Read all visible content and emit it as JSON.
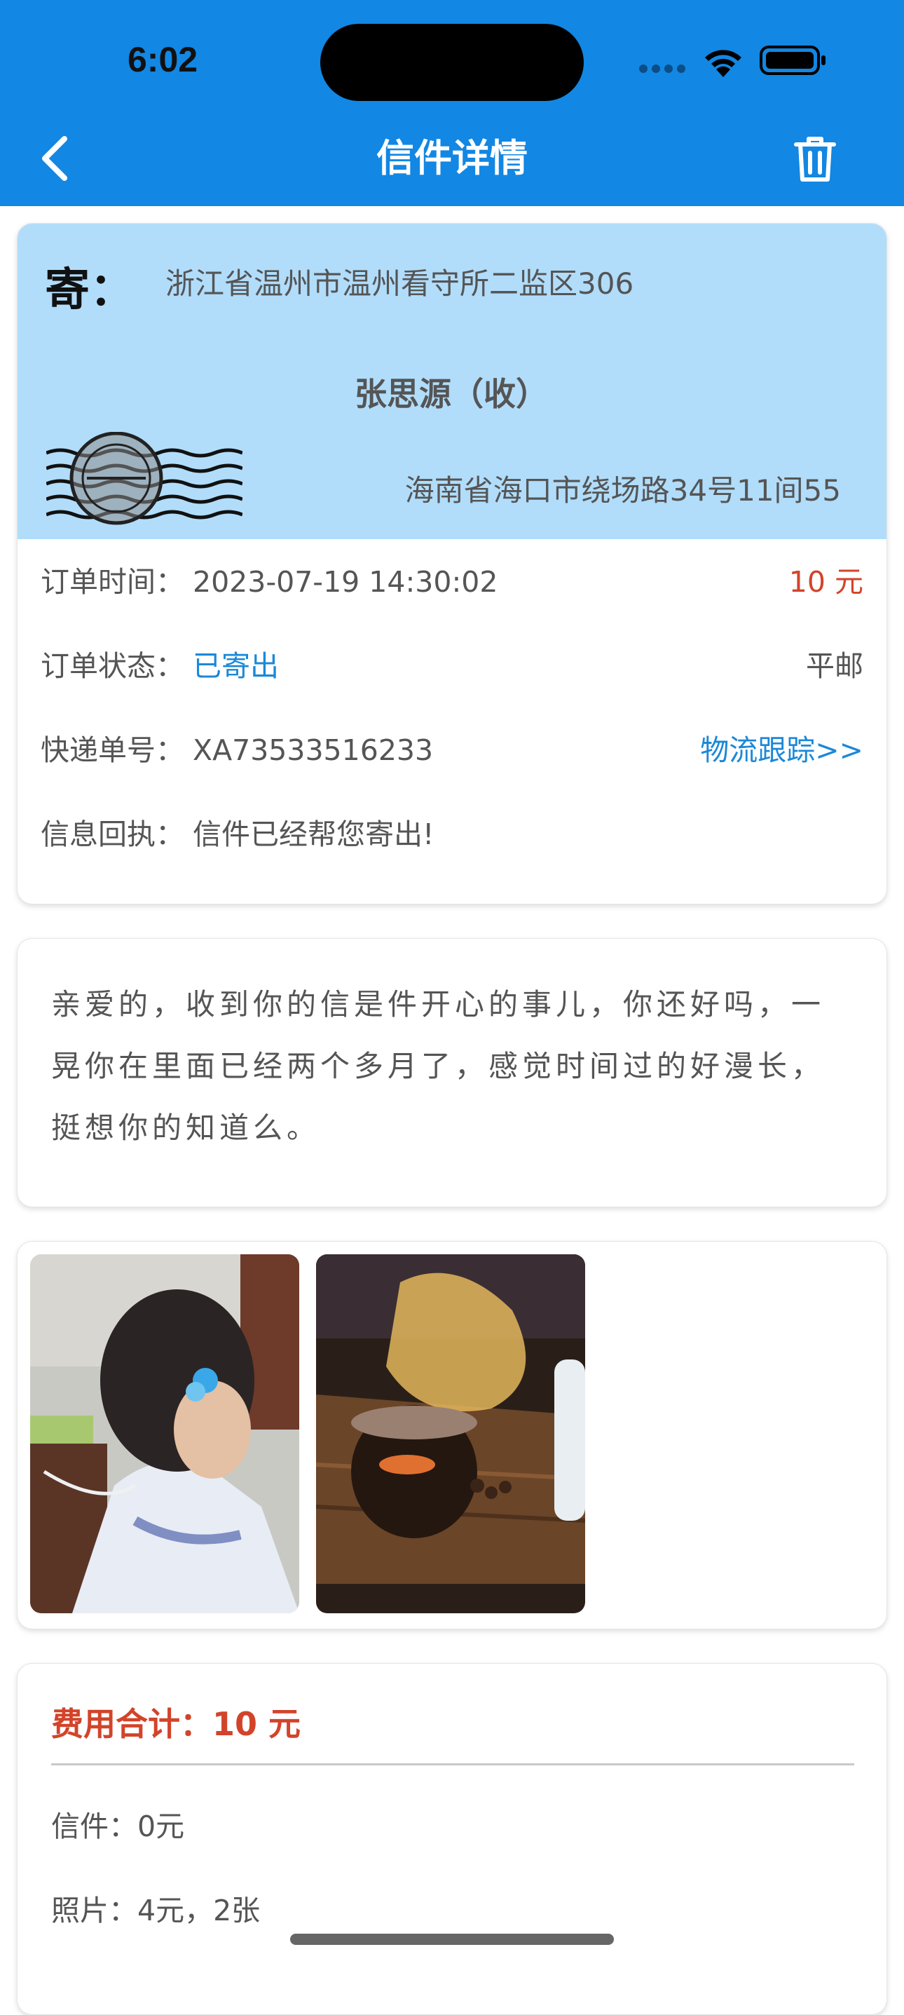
{
  "status_bar": {
    "time": "6:02"
  },
  "nav": {
    "title": "信件详情"
  },
  "envelope": {
    "sender_label": "寄：",
    "sender_address": "浙江省温州市温州看守所二监区306",
    "receiver_name": "张思源（收）",
    "receiver_address": "海南省海口市绕场路34号11间55"
  },
  "order": {
    "time_label": "订单时间：",
    "time_value": "2023-07-19 14:30:02",
    "price": "10 元",
    "status_label": "订单状态：",
    "status_value": "已寄出",
    "mail_type": "平邮",
    "tracking_label": "快递单号：",
    "tracking_value": "XA73533516233",
    "tracking_link": "物流跟踪>>",
    "receipt_label": "信息回执：",
    "receipt_value": "信件已经帮您寄出!"
  },
  "message": {
    "text": "亲爱的，收到你的信是件开心的事儿，你还好吗，一晃你在里面已经两个多月了，感觉时间过的好漫长，挺想你的知道么。"
  },
  "photos": [
    "girl-photo",
    "drink-photo"
  ],
  "fees": {
    "total_label": "费用合计：",
    "total_value": "10 元",
    "letter_line": "信件：0元",
    "photo_line": "照片：4元，2张"
  },
  "colors": {
    "header": "#1287e3",
    "envelope": "#b1ddfb",
    "accent_blue": "#1b88d8",
    "accent_red": "#d2442a"
  }
}
